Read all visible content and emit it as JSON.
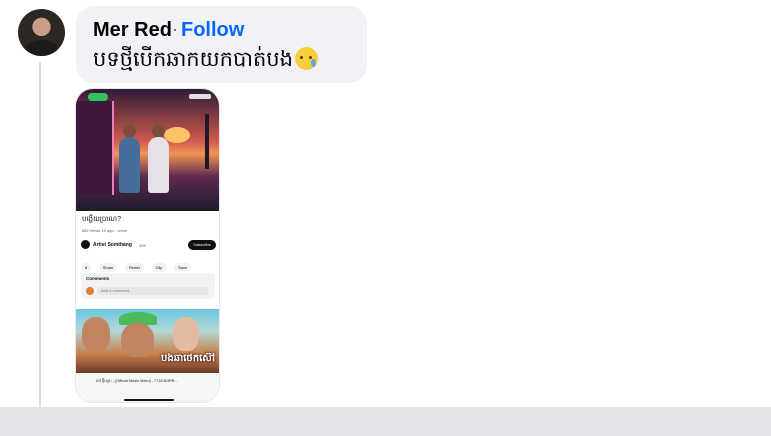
{
  "comment": {
    "author": "Mer Red",
    "separator": "·",
    "follow_label": "Follow",
    "text": "បទថ្មីបើកឆាកយកបាត់បង",
    "emoji": "crying-face-emoji"
  },
  "attachment": {
    "type": "screenshot",
    "video_title": "បង្ហើយប្រាណ?",
    "video_meta": "882 Views  10 ago  ...more",
    "channel_name": "Artist Somthang",
    "channel_subs": "30K",
    "subscribe_label": "Subscribe",
    "action_labels": [
      "8",
      "Share",
      "Remix",
      "Clip",
      "Save"
    ],
    "comments_label": "Comments",
    "comment_placeholder": "Add a comment...",
    "thumbnail_text": "បងឆាថេកស៊ៅ",
    "next_video_title": "ដាវ ថ្មីស្មោះ - [Official Music Video] - 7718 BORR..."
  },
  "colors": {
    "follow": "#0866ff",
    "bubble": "#f0f2f5",
    "thread_line": "#d9dadf"
  }
}
